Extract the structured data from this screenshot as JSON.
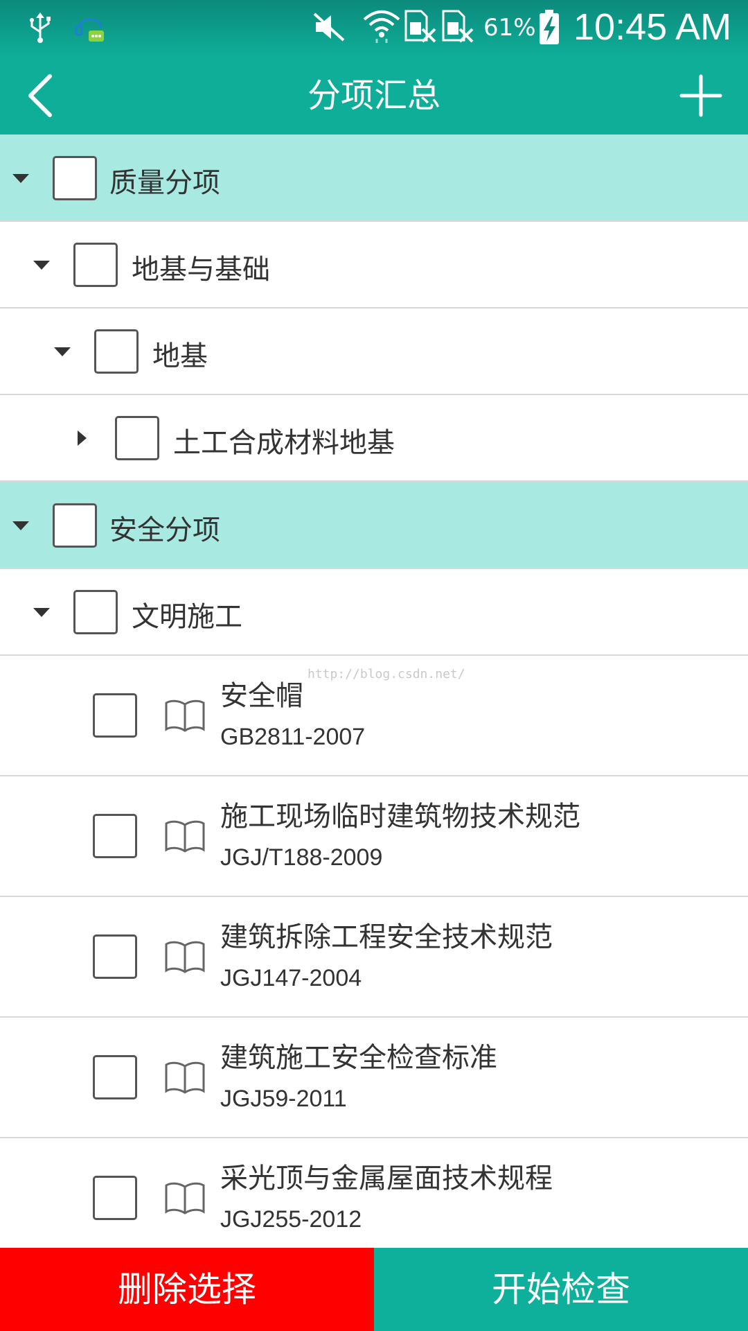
{
  "status_bar": {
    "battery_percent": "61%",
    "time": "10:45 AM",
    "icons": [
      "usb-icon",
      "notification-icon",
      "mute-icon",
      "wifi-icon",
      "no-sim-icon",
      "no-sim-icon",
      "battery-charging-icon"
    ]
  },
  "header": {
    "title": "分项汇总",
    "back_icon": "chevron-left-icon",
    "add_icon": "plus-icon"
  },
  "tree": {
    "group_quality": {
      "label": "质量分项",
      "expanded": true
    },
    "foundation_section": {
      "label": "地基与基础",
      "expanded": true
    },
    "foundation": {
      "label": "地基",
      "expanded": true
    },
    "geosynthetic": {
      "label": "土工合成材料地基",
      "expanded": false
    },
    "group_safety": {
      "label": "安全分项",
      "expanded": true
    },
    "civilized_construction": {
      "label": "文明施工",
      "expanded": true
    },
    "standards": [
      {
        "title": "安全帽",
        "code": "GB2811-2007"
      },
      {
        "title": "施工现场临时建筑物技术规范",
        "code": "JGJ/T188-2009"
      },
      {
        "title": "建筑拆除工程安全技术规范",
        "code": "JGJ147-2004"
      },
      {
        "title": "建筑施工安全检查标准",
        "code": "JGJ59-2011"
      },
      {
        "title": "采光顶与金属屋面技术规程",
        "code": "JGJ255-2012"
      }
    ]
  },
  "watermark": "http://blog.csdn.net/",
  "bottom_bar": {
    "delete_label": "删除选择",
    "start_label": "开始检查"
  },
  "colors": {
    "accent": "#0fae98",
    "group_highlight": "#a8e9e1",
    "delete": "#ff0000"
  }
}
